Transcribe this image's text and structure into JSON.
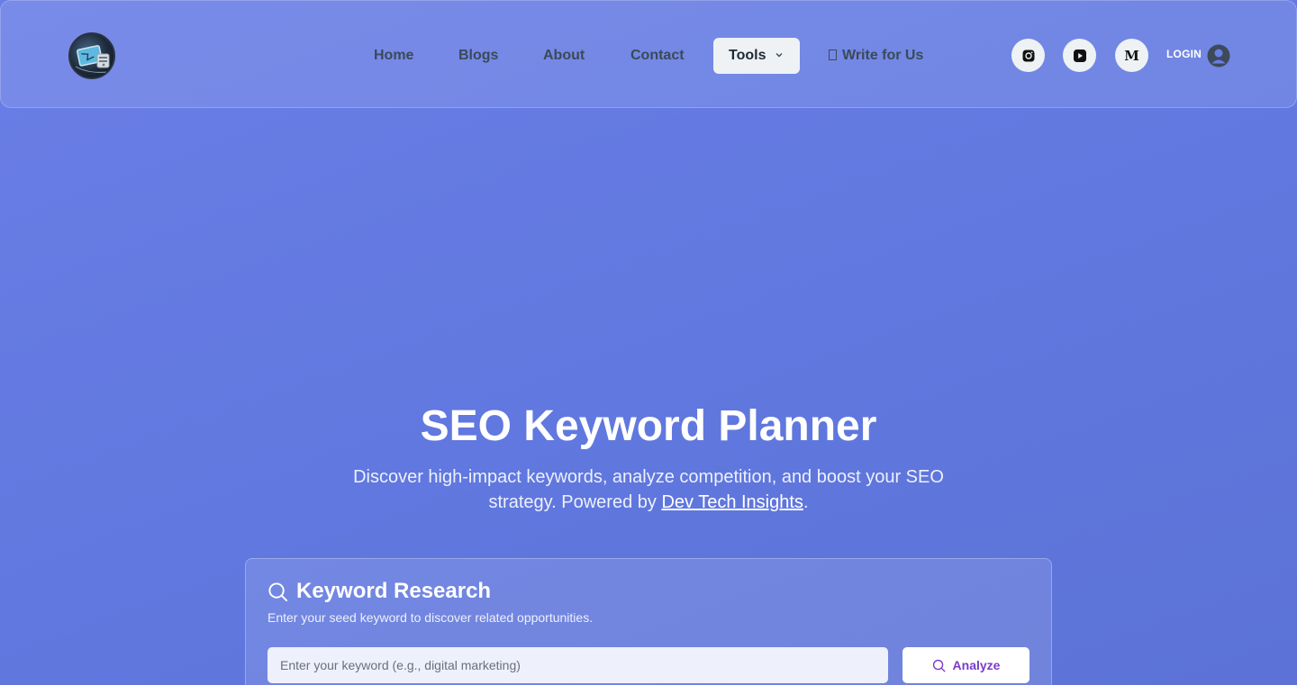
{
  "header": {
    "nav": {
      "home": "Home",
      "blogs": "Blogs",
      "about": "About",
      "contact": "Contact",
      "tools": "Tools",
      "write": "Write for Us"
    },
    "social": {
      "instagram_icon": "instagram-icon",
      "youtube_icon": "youtube-icon",
      "medium_label": "M"
    },
    "login": "LOGIN"
  },
  "hero": {
    "title": "SEO Keyword Planner",
    "subtitle_before": "Discover high-impact keywords, analyze competition, and boost your SEO strategy. Powered by ",
    "subtitle_link": "Dev Tech Insights",
    "subtitle_after": "."
  },
  "card": {
    "title": "Keyword Research",
    "subtitle": "Enter your seed keyword to discover related opportunities.",
    "input_placeholder": "Enter your keyword (e.g., digital marketing)",
    "button_label": "Analyze"
  },
  "colors": {
    "accent": "#7a3bc9",
    "background": "#6078df"
  }
}
